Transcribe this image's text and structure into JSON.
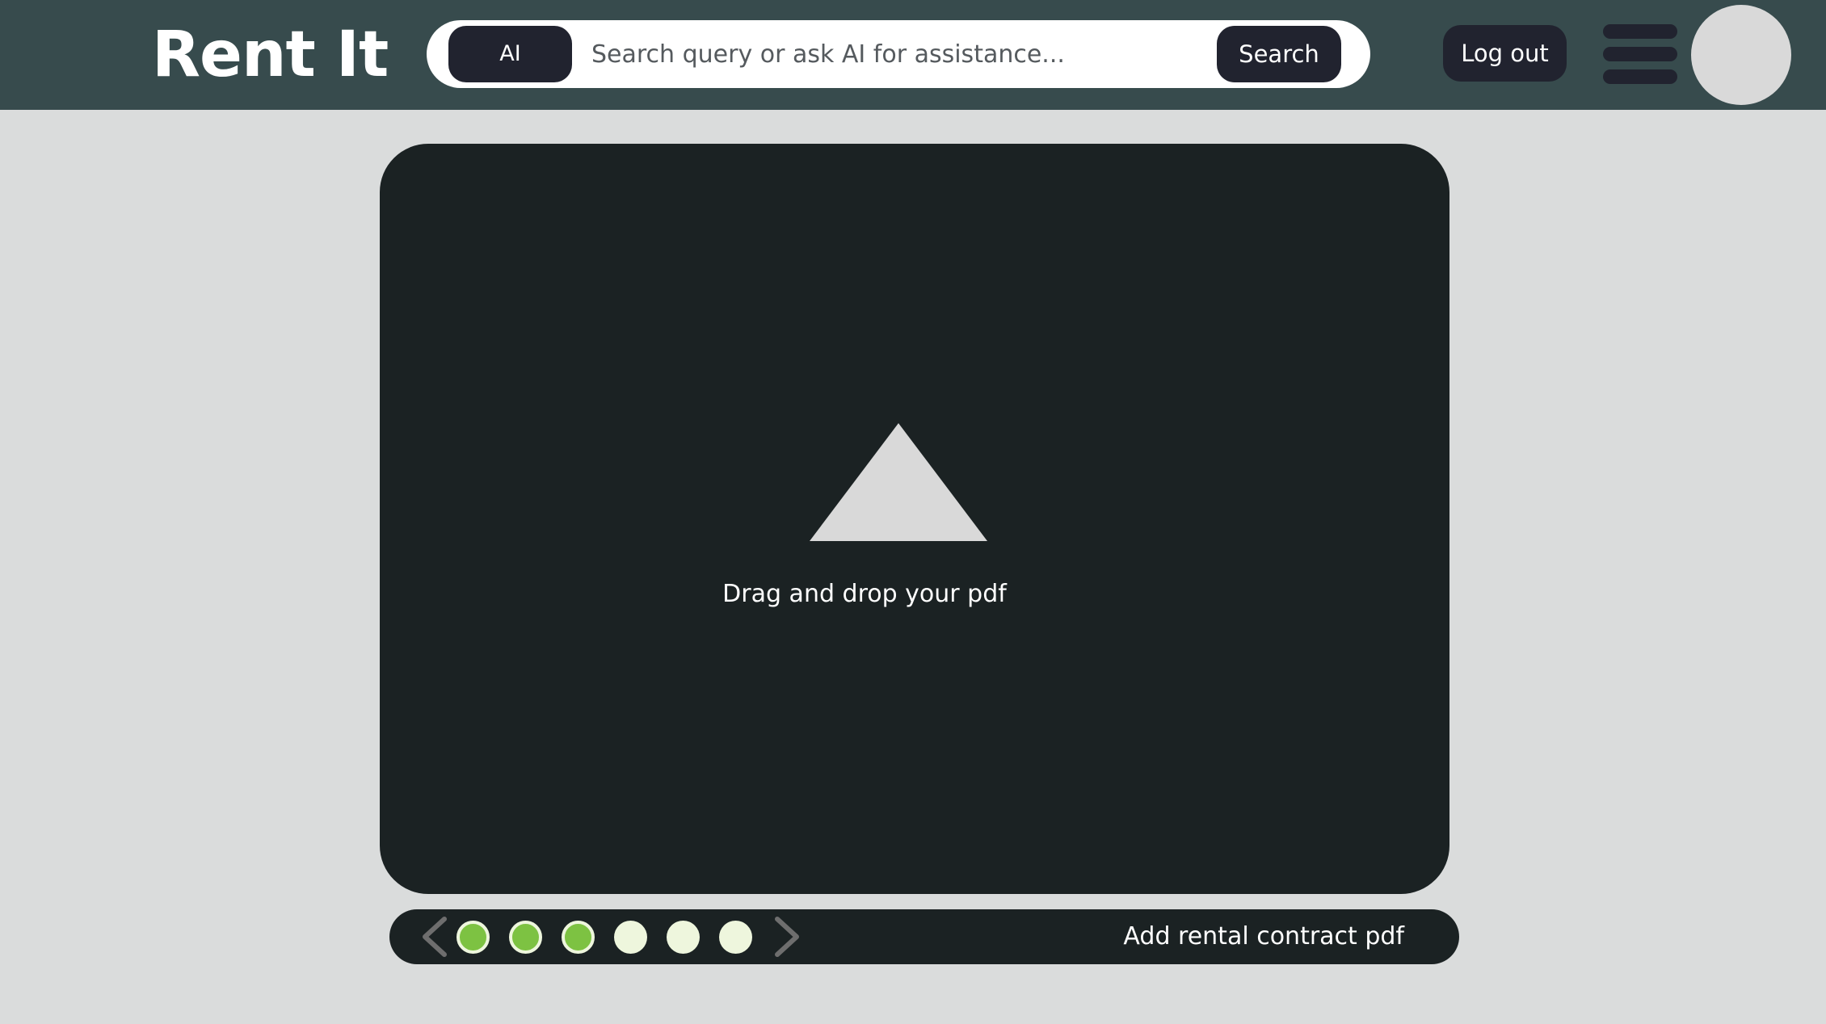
{
  "header": {
    "brand": "Rent It",
    "ai_button_label": "AI",
    "search_placeholder": "Search query or ask AI for assistance...",
    "search_button_label": "Search",
    "logout_label": "Log out",
    "menu_icon": "hamburger-menu-icon",
    "avatar_icon": "user-avatar"
  },
  "upload": {
    "prompt": "Drag and drop your pdf",
    "icon": "upload-triangle-icon"
  },
  "steps": {
    "prev_icon": "chevron-left-icon",
    "next_icon": "chevron-right-icon",
    "total": 6,
    "completed": 3,
    "current_label": "Add rental contract pdf",
    "completed_color": "#7dc242",
    "completed_ring_color": "#eef6dd",
    "pending_color": "#eef6dd"
  },
  "colors": {
    "header_bg": "#374b4d",
    "page_bg": "#dadcdc",
    "panel_bg": "#1b2223",
    "button_bg": "#21232f"
  }
}
